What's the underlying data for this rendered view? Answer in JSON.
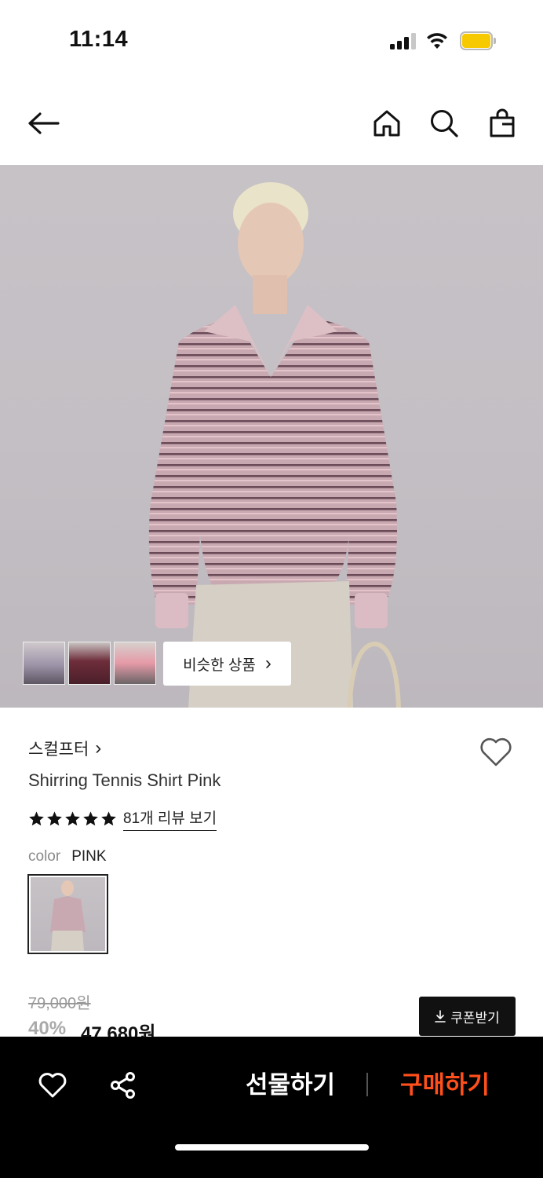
{
  "status_bar": {
    "time": "11:14"
  },
  "hero": {
    "similar_label": "비슷한 상품",
    "similar_chevron": "›"
  },
  "product": {
    "brand": "스컬프터",
    "brand_chevron": "›",
    "name": "Shirring Tennis Shirt Pink",
    "rating_stars": 5,
    "review_link": "81개 리뷰 보기",
    "color_label": "color",
    "color_value": "PINK"
  },
  "price": {
    "original": "79,000원",
    "discount": "40%",
    "sale": "47,680원",
    "coupon_label": "쿠폰받기"
  },
  "bottom_bar": {
    "gift_label": "선물하기",
    "buy_label": "구매하기"
  },
  "colors": {
    "accent": "#ff4f1a",
    "bottom_bar_bg": "#000000",
    "battery": "#f6c900"
  }
}
